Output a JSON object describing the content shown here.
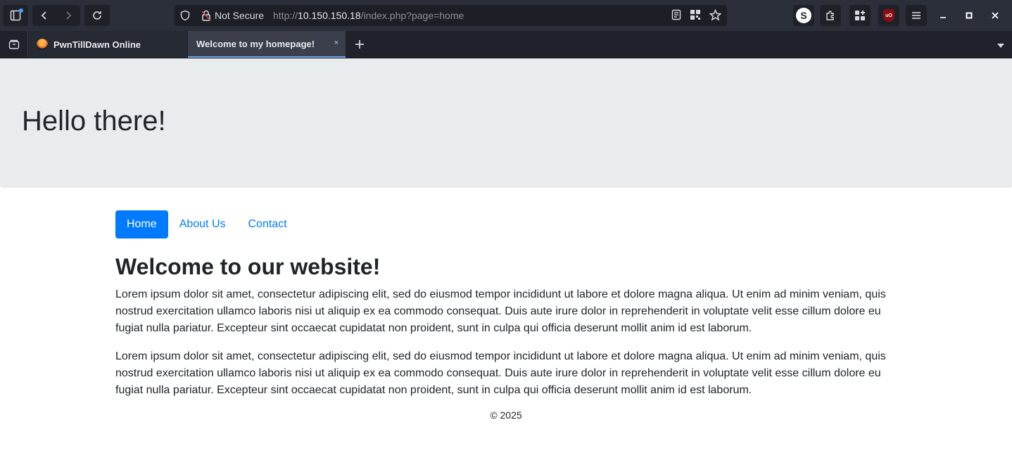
{
  "browser": {
    "url_security_label": "Not Secure",
    "url_prefix": "http://",
    "url_host": "10.150.150.18",
    "url_path": "/index.php?page=home",
    "profile_initial": "S",
    "ublock_label": "uO",
    "tabs": [
      {
        "label": "PwnTillDawn Online"
      },
      {
        "label": "Welcome to my homepage!",
        "close": "×"
      }
    ],
    "icons": {
      "sidebar": "sidebar-icon",
      "back": "chevron-left-icon",
      "forward": "chevron-right-icon",
      "reload": "reload-icon",
      "shield": "shield-icon",
      "lock": "lock-slash-icon",
      "reader": "reader-view-icon",
      "qr": "qr-code-icon",
      "bookmark": "star-icon",
      "extensions": "puzzle-icon",
      "apps": "apps-icon",
      "menu": "hamburger-icon"
    }
  },
  "page": {
    "hero_title": "Hello there!",
    "nav": [
      {
        "label": "Home",
        "active": true
      },
      {
        "label": "About Us",
        "active": false
      },
      {
        "label": "Contact",
        "active": false
      }
    ],
    "heading": "Welcome to our website!",
    "paragraphs": [
      "Lorem ipsum dolor sit amet, consectetur adipiscing elit, sed do eiusmod tempor incididunt ut labore et dolore magna aliqua. Ut enim ad minim veniam, quis nostrud exercitation ullamco laboris nisi ut aliquip ex ea commodo consequat. Duis aute irure dolor in reprehenderit in voluptate velit esse cillum dolore eu fugiat nulla pariatur. Excepteur sint occaecat cupidatat non proident, sunt in culpa qui officia deserunt mollit anim id est laborum.",
      "Lorem ipsum dolor sit amet, consectetur adipiscing elit, sed do eiusmod tempor incididunt ut labore et dolore magna aliqua. Ut enim ad minim veniam, quis nostrud exercitation ullamco laboris nisi ut aliquip ex ea commodo consequat. Duis aute irure dolor in reprehenderit in voluptate velit esse cillum dolore eu fugiat nulla pariatur. Excepteur sint occaecat cupidatat non proident, sunt in culpa qui officia deserunt mollit anim id est laborum."
    ],
    "footer": "© 2025"
  },
  "colors": {
    "primary": "#007bff",
    "jumbotron_bg": "#e9ecef",
    "text": "#212529",
    "chrome_bg": "#2b2f3a"
  }
}
